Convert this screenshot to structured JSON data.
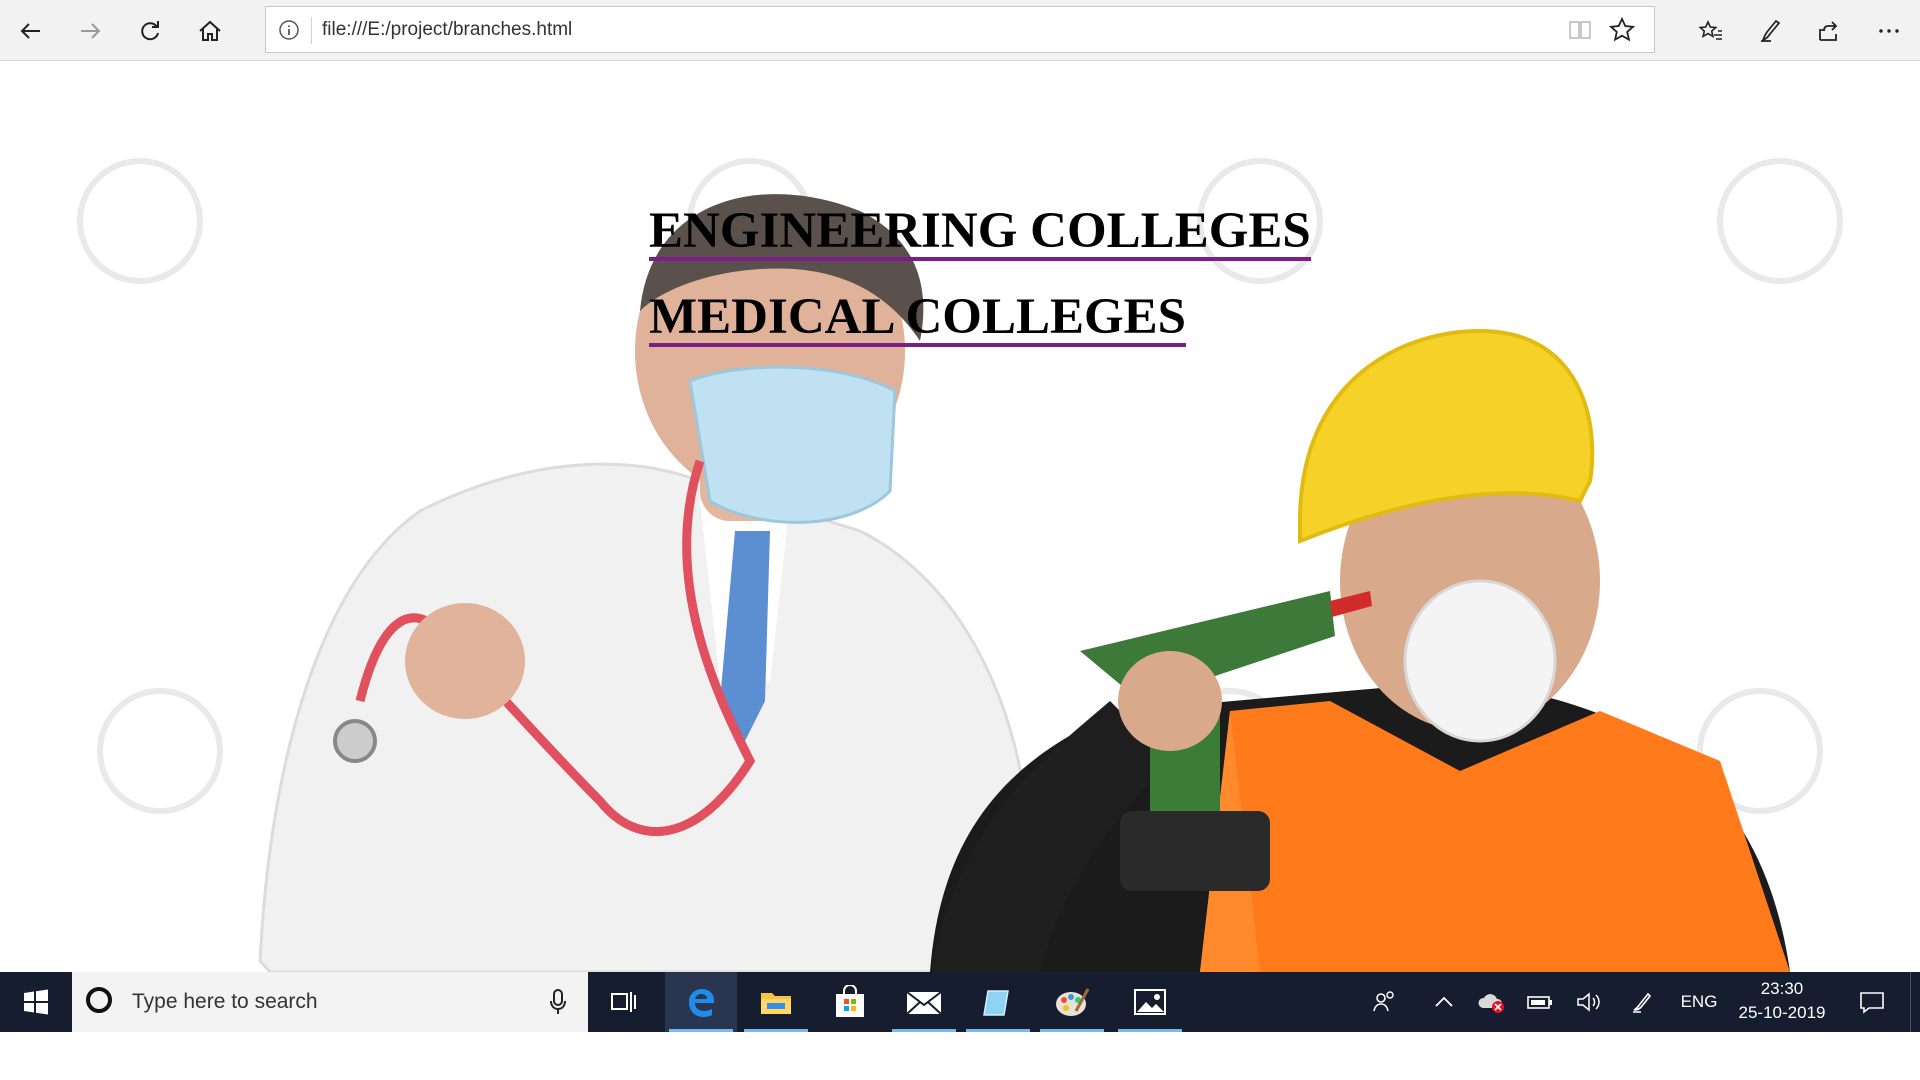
{
  "browser": {
    "url": "file:///E:/project/branches.html",
    "icons": [
      "back-icon",
      "forward-icon",
      "refresh-icon",
      "home-icon",
      "info-icon",
      "reading-view-icon",
      "favorite-star-icon",
      "favorites-hub-icon",
      "pen-icon",
      "share-icon",
      "more-icon"
    ]
  },
  "page": {
    "links": [
      {
        "label": "ENGINEERING COLLEGES"
      },
      {
        "label": "MEDICAL COLLEGES"
      }
    ],
    "link_underline_color": "#7b1f86"
  },
  "taskbar": {
    "search_placeholder": "Type here to search",
    "language": "ENG",
    "time": "23:30",
    "date": "25-10-2019",
    "apps": [
      "task-view",
      "edge",
      "file-explorer",
      "store",
      "mail",
      "app",
      "paint",
      "photos"
    ]
  }
}
